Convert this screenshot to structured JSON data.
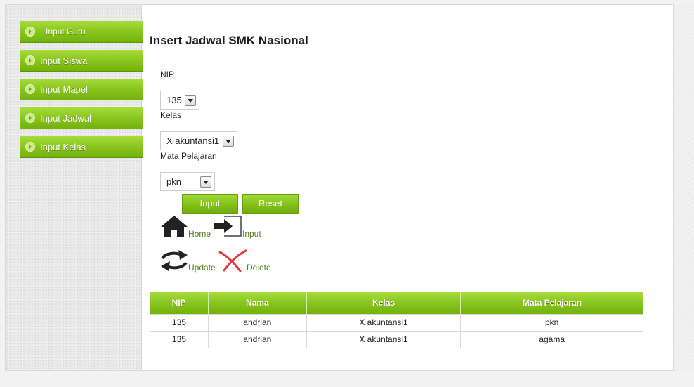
{
  "sidebar": {
    "items": [
      {
        "label": "Input Guru"
      },
      {
        "label": "Input Siswa"
      },
      {
        "label": "Input Mapel"
      },
      {
        "label": "Input Jadwal"
      },
      {
        "label": "Input Kelas"
      }
    ]
  },
  "form": {
    "title": "Insert Jadwal SMK Nasional",
    "nip_label": "NIP",
    "nip_value": "135",
    "kelas_label": "Kelas",
    "kelas_value": "X akuntansi1",
    "mapel_label": "Mata Pelajaran",
    "mapel_value": "pkn",
    "input_button": "Input",
    "reset_button": "Reset"
  },
  "actions": {
    "home": "Home",
    "input": "Input",
    "update": "Update",
    "delete": "Delete"
  },
  "icons": {
    "home": "home-icon",
    "input": "enter-icon",
    "update": "swap-arrows-icon",
    "delete": "x-delete-icon"
  },
  "table": {
    "headers": [
      "NIP",
      "Nama",
      "Kelas",
      "Mata Pelajaran"
    ],
    "rows": [
      [
        "135",
        "andrian",
        "X akuntansi1",
        "pkn"
      ],
      [
        "135",
        "andrian",
        "X akuntansi1",
        "agama"
      ]
    ]
  },
  "colors": {
    "accent_green": "#86c41c",
    "link_green": "#4f7f11",
    "delete_red": "#e23a3a"
  }
}
